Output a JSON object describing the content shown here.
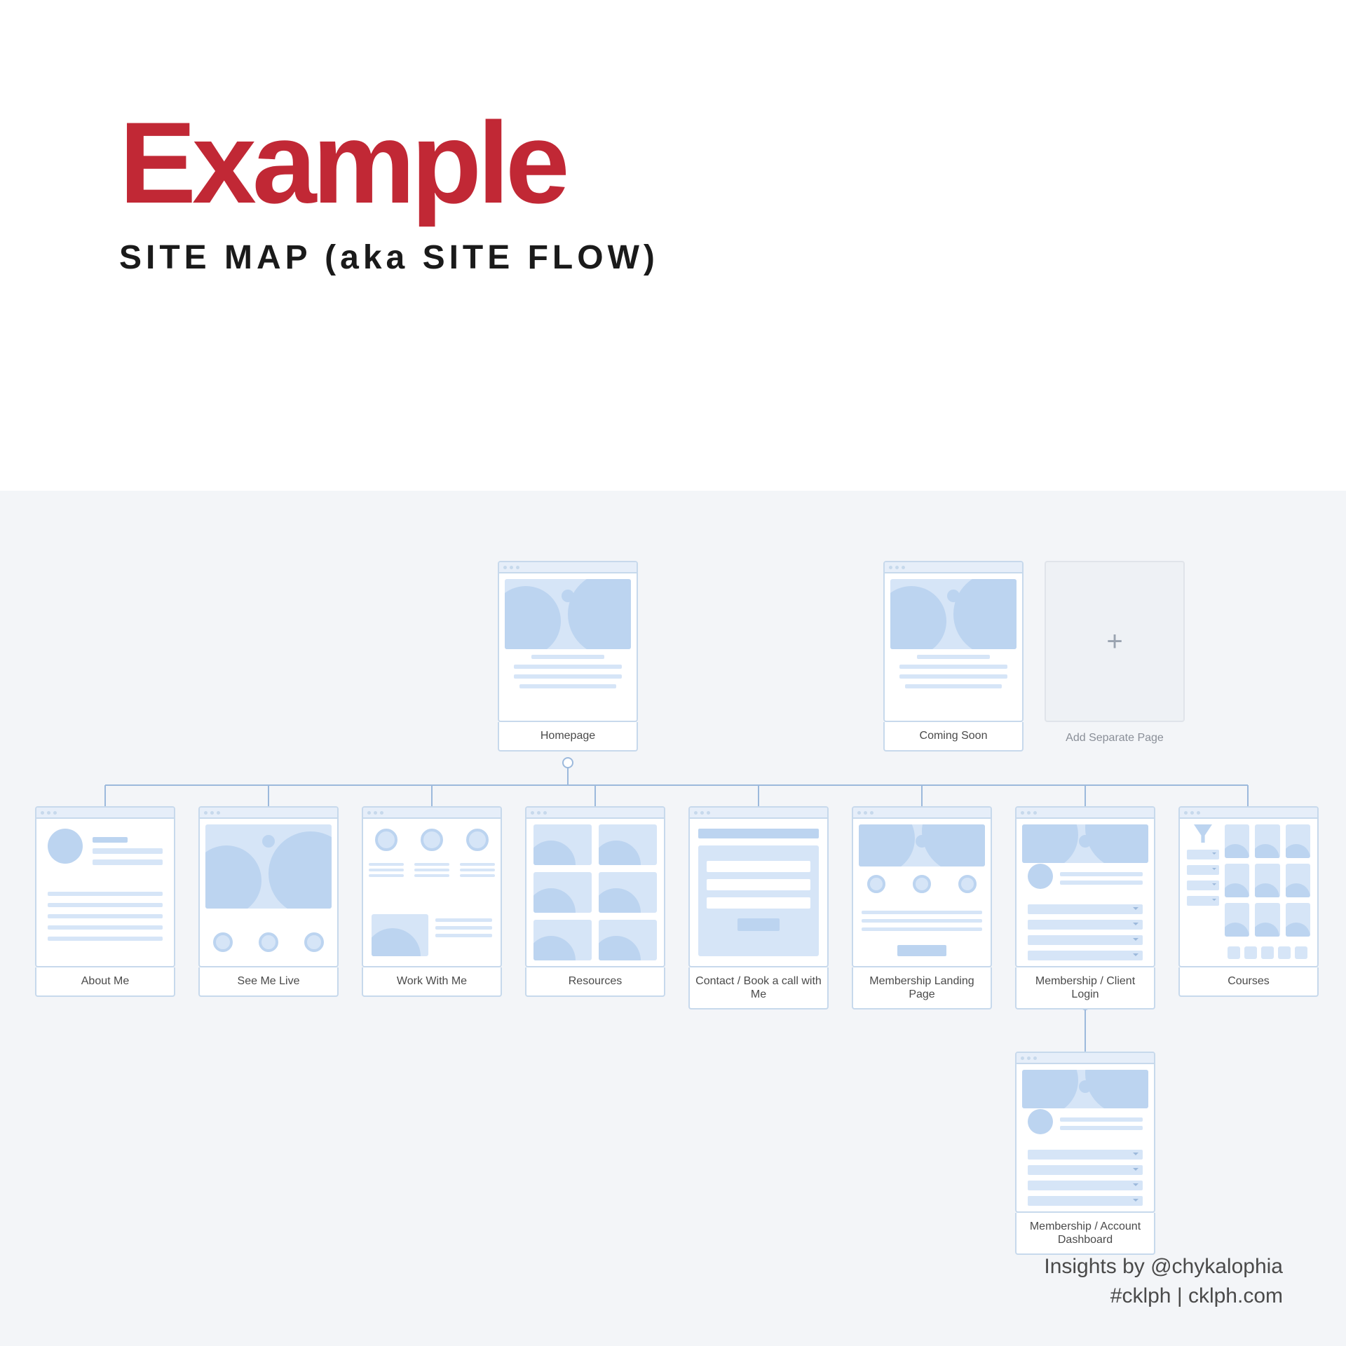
{
  "header": {
    "title": "Example",
    "subtitle": "SITE MAP (aka SITE FLOW)"
  },
  "top_row": {
    "homepage": "Homepage",
    "coming_soon": "Coming Soon",
    "add_page": "Add Separate Page"
  },
  "children": [
    "About Me",
    "See Me Live",
    "Work With Me",
    "Resources",
    "Contact / Book a call with Me",
    "Membership Landing Page",
    "Membership / Client Login",
    "Courses"
  ],
  "grandchild": "Membership  / Account Dashboard",
  "footer": {
    "line1": "Insights by @chykalophia",
    "line2": "#cklph | cklph.com"
  },
  "colors": {
    "accent": "#c12835",
    "wire_blue": "#9cb9dc",
    "fill_blue": "#d6e5f7",
    "canvas_bg": "#f3f5f8"
  }
}
